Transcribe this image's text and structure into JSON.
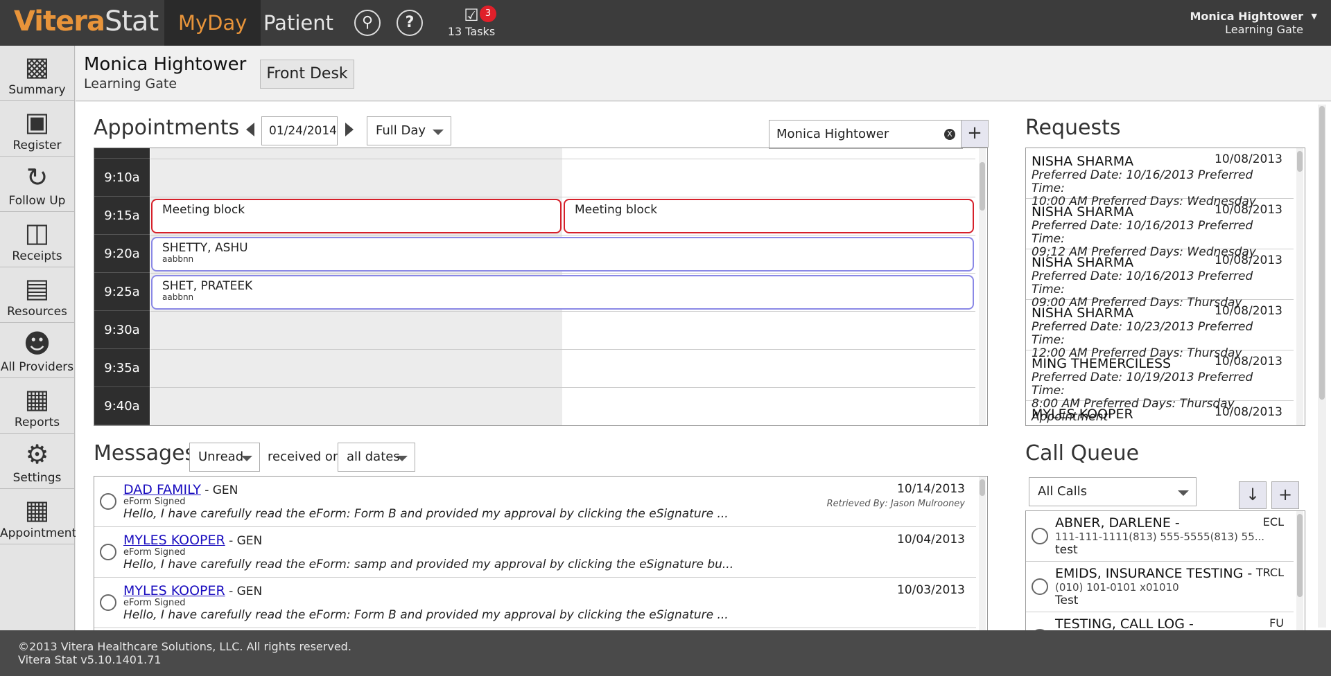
{
  "app": {
    "logo_a": "Vitera",
    "logo_b": "Stat"
  },
  "nav": {
    "tabs": [
      {
        "label": "MyDay"
      },
      {
        "label": "Patient"
      }
    ],
    "search_icon": "search-icon",
    "help_icon": "help-icon",
    "tasks_label": "13 Tasks",
    "tasks_badge": "3"
  },
  "user": {
    "name": "Monica Hightower",
    "location": "Learning Gate"
  },
  "sidebar": {
    "items": [
      {
        "label": "Summary",
        "icon": "summary-icon"
      },
      {
        "label": "Register",
        "icon": "register-icon"
      },
      {
        "label": "Follow Up",
        "icon": "follow-up-icon"
      },
      {
        "label": "Receipts",
        "icon": "receipts-icon"
      },
      {
        "label": "Resources",
        "icon": "resources-icon"
      },
      {
        "label": "All Providers",
        "icon": "providers-icon"
      },
      {
        "label": "Reports",
        "icon": "reports-icon"
      },
      {
        "label": "Settings",
        "icon": "gear-icon"
      },
      {
        "label": "Appointment",
        "icon": "calendar-icon"
      }
    ]
  },
  "header": {
    "name": "Monica Hightower",
    "location": "Learning Gate",
    "role_button": "Front Desk"
  },
  "appointments": {
    "title": "Appointments",
    "date": "01/24/2014",
    "view": "Full Day",
    "provider_search": "Monica Hightower",
    "clear_label": "X",
    "add_label": "+",
    "times": [
      "9:10a",
      "9:15a",
      "9:20a",
      "9:25a",
      "9:30a",
      "9:35a",
      "9:40a"
    ],
    "blocks": [
      {
        "title": "Meeting block",
        "sub": ""
      },
      {
        "title": "Meeting block",
        "sub": ""
      },
      {
        "title": "SHETTY, ASHU",
        "sub": "aabbnn"
      },
      {
        "title": "SHET, PRATEEK",
        "sub": "aabbnn"
      }
    ]
  },
  "requests": {
    "title": "Requests",
    "items": [
      {
        "name": "NISHA SHARMA",
        "date": "10/08/2013",
        "line1": "Preferred Date: 10/16/2013 Preferred Time:",
        "line2": "10:00 AM Preferred Days: Wednesday"
      },
      {
        "name": "NISHA SHARMA",
        "date": "10/08/2013",
        "line1": "Preferred Date: 10/16/2013 Preferred Time:",
        "line2": "09;12 AM Preferred Days: Wednesday"
      },
      {
        "name": "NISHA SHARMA",
        "date": "10/08/2013",
        "line1": "Preferred Date: 10/16/2013 Preferred Time:",
        "line2": "09:00 AM Preferred Days: Thursday"
      },
      {
        "name": "NISHA SHARMA",
        "date": "10/08/2013",
        "line1": "Preferred Date: 10/23/2013 Preferred Time:",
        "line2": "12:00 AM Preferred Days: Thursday"
      },
      {
        "name": "MING THEMERCILESS",
        "date": "10/08/2013",
        "line1": "Preferred Date: 10/19/2013 Preferred Time:",
        "line2": "8:00 AM Preferred Days: Thursday Appointment"
      },
      {
        "name": "MYLES KOOPER",
        "date": "10/08/2013",
        "line1": "",
        "line2": ""
      }
    ]
  },
  "messages": {
    "title": "Messages",
    "filter": "Unread",
    "received_label": "received on",
    "date_filter": "all dates",
    "items": [
      {
        "name": "DAD FAMILY",
        "cat": " - GEN",
        "sub": "eForm Signed",
        "body": "Hello, I have carefully read the eForm: Form B and provided my approval by clicking the eSignature ...",
        "date": "10/14/2013",
        "retrieved": "Retrieved By: Jason Mulrooney"
      },
      {
        "name": "MYLES KOOPER",
        "cat": " - GEN",
        "sub": "eForm Signed",
        "body": "Hello, I have carefully read the eForm: samp and provided my approval by clicking the eSignature bu...",
        "date": "10/04/2013",
        "retrieved": ""
      },
      {
        "name": "MYLES KOOPER",
        "cat": " - GEN",
        "sub": "eForm Signed",
        "body": "Hello, I have carefully read the eForm: Form B and provided my approval by clicking the eSignature ...",
        "date": "10/03/2013",
        "retrieved": ""
      }
    ]
  },
  "call_queue": {
    "title": "Call Queue",
    "filter": "All Calls",
    "down_label": "↓",
    "add_label": "+",
    "items": [
      {
        "name": "ABNER, DARLENE -",
        "phone": "111-111-1111(813) 555-5555(813) 55...",
        "note": "test",
        "type": "ECL"
      },
      {
        "name": "EMIDS, INSURANCE TESTING -",
        "phone": "(010) 101-0101 x01010",
        "note": "Test",
        "type": "TRCL"
      },
      {
        "name": "TESTING, CALL LOG -",
        "phone": "",
        "note": "",
        "type": "FU"
      }
    ]
  },
  "footer": {
    "copyright": "©2013 Vitera Healthcare Solutions, LLC. All rights reserved.",
    "version": "Vitera Stat v5.10.1401.71"
  }
}
